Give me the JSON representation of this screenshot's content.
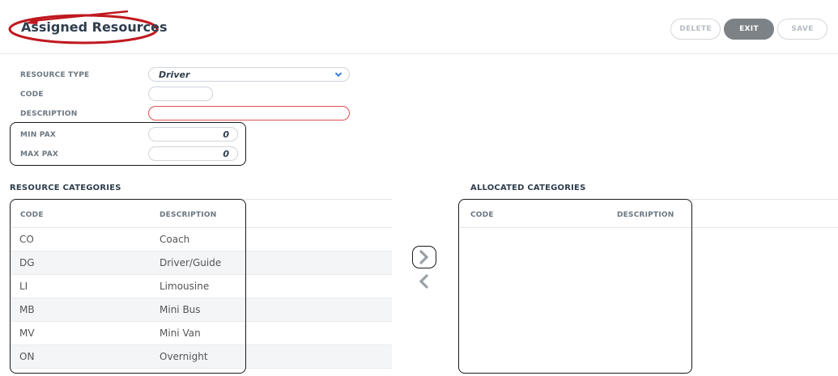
{
  "header": {
    "title": "Assigned Resources",
    "buttons": {
      "delete": "DELETE",
      "exit": "EXIT",
      "save": "SAVE"
    }
  },
  "form": {
    "resource_type": {
      "label": "RESOURCE TYPE",
      "value": "Driver"
    },
    "code": {
      "label": "CODE",
      "value": ""
    },
    "description": {
      "label": "DESCRIPTION",
      "value": ""
    },
    "min_pax": {
      "label": "MIN PAX",
      "value": "0"
    },
    "max_pax": {
      "label": "MAX PAX",
      "value": "0"
    }
  },
  "resource_categories": {
    "title": "RESOURCE CATEGORIES",
    "columns": {
      "code": "CODE",
      "description": "DESCRIPTION"
    },
    "rows": [
      {
        "code": "CO",
        "description": "Coach"
      },
      {
        "code": "DG",
        "description": "Driver/Guide"
      },
      {
        "code": "LI",
        "description": "Limousine"
      },
      {
        "code": "MB",
        "description": "Mini Bus"
      },
      {
        "code": "MV",
        "description": "Mini Van"
      },
      {
        "code": "ON",
        "description": "Overnight"
      }
    ]
  },
  "allocated_categories": {
    "title": "ALLOCATED CATEGORIES",
    "columns": {
      "code": "CODE",
      "description": "DESCRIPTION"
    },
    "rows": []
  },
  "icons": {
    "move_right": "chevron-right-icon",
    "move_left": "chevron-left-icon",
    "dropdown": "chevron-down-icon"
  },
  "colors": {
    "title": "#2f3e4e",
    "annotation_red": "#c0181f",
    "invalid_border": "#e05050",
    "exit_button": "#7d8287",
    "dropdown_chevron": "#3a7bd5"
  }
}
